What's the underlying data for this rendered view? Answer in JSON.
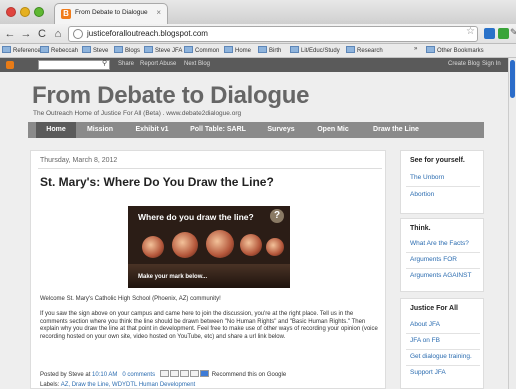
{
  "browser": {
    "tab_title": "From Debate to Dialogue",
    "tab_close": "×",
    "url": "justiceforalloutreach.blogspot.com",
    "bookmarks": [
      "Reference",
      "Rebeccah",
      "Steve",
      "Blogs",
      "Steve JFA",
      "Common",
      "Home",
      "Birth",
      "Lit/Educ/Study",
      "Research"
    ],
    "bookmarks_overflow": "»",
    "other_bookmarks": "Other Bookmarks"
  },
  "blogger_bar": {
    "links": [
      "Share",
      "Report Abuse",
      "Next Blog"
    ],
    "right_links": [
      "Create Blog",
      "Sign In"
    ]
  },
  "blog": {
    "title": "From Debate to Dialogue",
    "description": "The Outreach Home of Justice For All (Beta) . www.debate2dialogue.org",
    "nav": [
      "Home",
      "Mission",
      "Exhibit v1",
      "Poll Table: SARL",
      "Surveys",
      "Open Mic",
      "Draw the Line"
    ]
  },
  "post": {
    "date": "Thursday, March 8, 2012",
    "title": "St. Mary's: Where Do You Draw the Line?",
    "image_headline": "Where do you draw the line?",
    "image_caption": "Make your mark below...",
    "welcome": "Welcome St. Mary's Catholic High School (Phoenix, AZ) community!",
    "body": "If you saw the sign above on your campus and came here to join the discussion, you're at the right place.  Tell us in the comments section where you think the line should be drawn between \"No Human Rights\" and \"Basic Human Rights.\"  Then explain why you draw the line at that point in development.  Feel free to make use of other ways of recording your opinion (voice recording hosted on your own site, video hosted on YouTube, etc) and share a url link below.",
    "posted_by": "Posted by Steve at",
    "time": "10:10 AM",
    "comments": "0 comments",
    "recommend": "Recommend this on Google",
    "labels_prefix": "Labels:",
    "labels": "AZ, Draw the Line, WDYDTL Human Development"
  },
  "sidebar": {
    "sections": [
      {
        "heading": "See for yourself.",
        "links": [
          "The Unborn",
          "Abortion"
        ]
      },
      {
        "heading": "Think.",
        "links": [
          "What Are the Facts?",
          "Arguments FOR",
          "Arguments AGAINST"
        ]
      },
      {
        "heading": "Justice For All",
        "links": [
          "About JFA",
          "JFA on FB",
          "Get dialogue training.",
          "Support JFA"
        ]
      }
    ]
  }
}
